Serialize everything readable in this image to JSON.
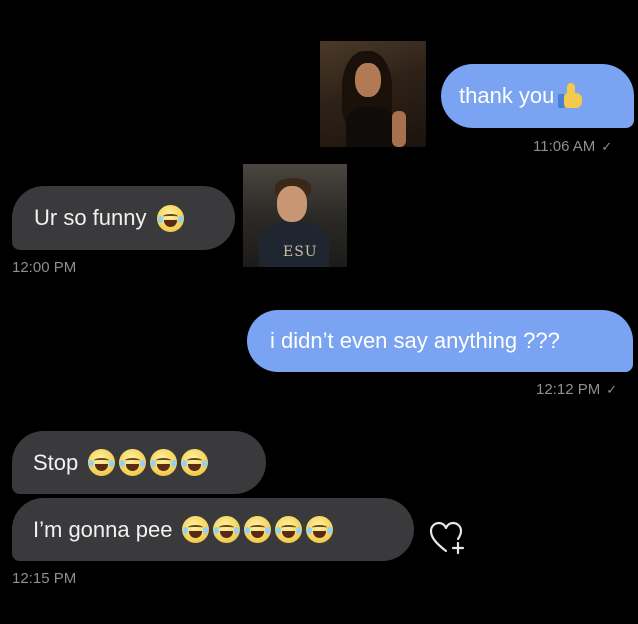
{
  "messages": [
    {
      "id": "m1",
      "direction": "outgoing",
      "text": "thank you",
      "trailing": "thumbs-up-emoji",
      "time": "11:06 AM",
      "status": "✓"
    },
    {
      "id": "m2",
      "direction": "incoming",
      "text": "Ur so funny",
      "trailing_count": 1,
      "trailing": "laughing-crying-emoji",
      "time": "12:00 PM"
    },
    {
      "id": "m3",
      "direction": "outgoing",
      "text": "i didn’t even say anything ???",
      "time": "12:12 PM",
      "status": "✓"
    },
    {
      "id": "m4",
      "direction": "incoming",
      "text": "Stop",
      "trailing_count": 4,
      "trailing": "laughing-crying-emoji"
    },
    {
      "id": "m5",
      "direction": "incoming",
      "text": "I’m gonna pee",
      "trailing_count": 5,
      "trailing": "laughing-crying-emoji",
      "time": "12:15 PM"
    }
  ],
  "images": [
    {
      "name": "woman-photo",
      "description_icon": "photo"
    },
    {
      "name": "man-photo",
      "logo_text": "ESU"
    }
  ],
  "react_icon": "heart-plus-icon",
  "colors": {
    "background": "#000000",
    "outgoing_bubble": "#7aa3f1",
    "incoming_bubble": "#3a3a3d",
    "timestamp": "#8e8e93"
  }
}
